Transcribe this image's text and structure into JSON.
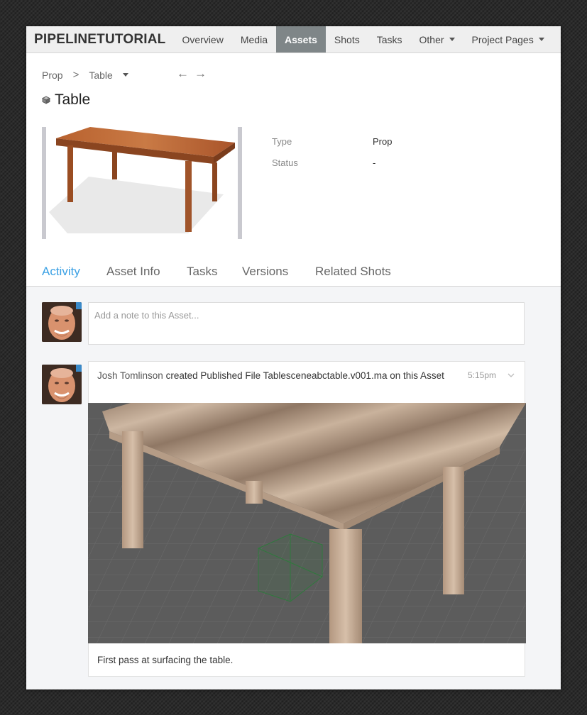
{
  "nav": {
    "brand": "PIPELINETUTORIAL",
    "items": [
      {
        "label": "Overview"
      },
      {
        "label": "Media"
      },
      {
        "label": "Assets",
        "active": true
      },
      {
        "label": "Shots"
      },
      {
        "label": "Tasks"
      },
      {
        "label": "Other",
        "dropdown": true
      },
      {
        "label": "Project Pages",
        "dropdown": true
      }
    ]
  },
  "breadcrumb": {
    "parent": "Prop",
    "separator": ">",
    "current": "Table",
    "back_arrow": "←",
    "forward_arrow": "→"
  },
  "page": {
    "icon": "cube-icon",
    "title": "Table"
  },
  "fields": {
    "type_label": "Type",
    "type_value": "Prop",
    "status_label": "Status",
    "status_value": "-"
  },
  "tabs": [
    {
      "label": "Activity",
      "active": true
    },
    {
      "label": "Asset Info"
    },
    {
      "label": "Tasks"
    },
    {
      "label": "Versions"
    },
    {
      "label": "Related Shots"
    }
  ],
  "activity": {
    "note_placeholder": "Add a note to this Asset...",
    "entry": {
      "user": "Josh Tomlinson",
      "action": "created Published File Tablesceneabctable.v001.ma on this Asset",
      "time": "5:15pm",
      "caption": "First pass at surfacing the table."
    }
  },
  "colors": {
    "accent": "#3aa0e4",
    "nav_active_bg": "#7f8688",
    "nav_bg": "#efefef"
  }
}
